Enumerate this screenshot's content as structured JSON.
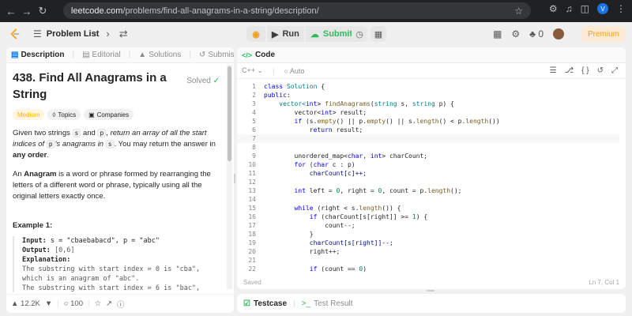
{
  "browser": {
    "url_host": "leetcode.com",
    "url_path": "/problems/find-all-anagrams-in-a-string/description/",
    "profile_initial": "V"
  },
  "topbar": {
    "problem_list_label": "Problem List",
    "run_label": "Run",
    "submit_label": "Submit",
    "fire_count": "0",
    "premium_label": "Premium"
  },
  "left": {
    "tabs": [
      {
        "label": "Description"
      },
      {
        "label": "Editorial"
      },
      {
        "label": "Solutions"
      },
      {
        "label": "Submissions"
      }
    ],
    "title": "438. Find All Anagrams in a String",
    "solved_label": "Solved",
    "chips": {
      "difficulty": "Medium",
      "topics": "Topics",
      "companies": "Companies"
    },
    "desc1": {
      "a": "Given two strings ",
      "s": "s",
      "b": " and ",
      "p": "p",
      "c": ", ",
      "d": "return an array of all the start indices of ",
      "p2": "p",
      "e": "'s anagrams in ",
      "s2": "s",
      "f": ". You may return the answer in ",
      "g": "any order",
      "h": "."
    },
    "desc2": {
      "a": "An ",
      "b": "Anagram",
      "c": " is a word or phrase formed by rearranging the letters of a different word or phrase, typically using all the original letters exactly once."
    },
    "example_title": "Example 1:",
    "example": {
      "input_label": "Input:",
      "input_value": " s = \"cbaebabacd\", p = \"abc\"",
      "output_label": "Output:",
      "output_value": " [0,6]",
      "explanation_label": "Explanation:",
      "lines": [
        "The substring with start index = 0 is \"cba\",",
        "which is an anagram of \"abc\".",
        "The substring with start index = 6 is \"bac\","
      ]
    },
    "footer": {
      "likes": "12.2K",
      "comments": "100"
    }
  },
  "editor": {
    "tab_label": "Code",
    "language": "C++",
    "mode": "Auto",
    "code_lines": [
      [
        {
          "t": "class ",
          "c": "kw"
        },
        {
          "t": "Solution",
          "c": "ty"
        },
        {
          "t": " {"
        }
      ],
      [
        {
          "t": "public",
          "c": "kw"
        },
        {
          "t": ":"
        }
      ],
      [
        {
          "t": "    vector<",
          "c": "ty"
        },
        {
          "t": "int",
          "c": "kw"
        },
        {
          "t": "> "
        },
        {
          "t": "findAnagrams",
          "c": "fn"
        },
        {
          "t": "("
        },
        {
          "t": "string",
          "c": "ty"
        },
        {
          "t": " s, "
        },
        {
          "t": "string",
          "c": "ty"
        },
        {
          "t": " p) {"
        }
      ],
      [
        {
          "t": "        vector<"
        },
        {
          "t": "int",
          "c": "kw"
        },
        {
          "t": "> result;"
        }
      ],
      [
        {
          "t": "        "
        },
        {
          "t": "if",
          "c": "kw"
        },
        {
          "t": " (s."
        },
        {
          "t": "empty",
          "c": "fn"
        },
        {
          "t": "() || p."
        },
        {
          "t": "empty",
          "c": "fn"
        },
        {
          "t": "() || s."
        },
        {
          "t": "length",
          "c": "fn"
        },
        {
          "t": "() < p."
        },
        {
          "t": "length",
          "c": "fn"
        },
        {
          "t": "())"
        }
      ],
      [
        {
          "t": "            "
        },
        {
          "t": "return",
          "c": "kw"
        },
        {
          "t": " result;"
        }
      ],
      [
        {
          "t": ""
        }
      ],
      [
        {
          "t": ""
        }
      ],
      [
        {
          "t": "        unordered_map<"
        },
        {
          "t": "char",
          "c": "kw"
        },
        {
          "t": ", "
        },
        {
          "t": "int",
          "c": "kw"
        },
        {
          "t": "> charCount;"
        }
      ],
      [
        {
          "t": "        "
        },
        {
          "t": "for",
          "c": "kw"
        },
        {
          "t": " ("
        },
        {
          "t": "char",
          "c": "kw"
        },
        {
          "t": " c : p)"
        }
      ],
      [
        {
          "t": "            charCount[c]++;",
          "c": "va"
        }
      ],
      [
        {
          "t": ""
        }
      ],
      [
        {
          "t": "        "
        },
        {
          "t": "int",
          "c": "kw"
        },
        {
          "t": " left = "
        },
        {
          "t": "0",
          "c": "nu"
        },
        {
          "t": ", right = "
        },
        {
          "t": "0",
          "c": "nu"
        },
        {
          "t": ", count = p."
        },
        {
          "t": "length",
          "c": "fn"
        },
        {
          "t": "();"
        }
      ],
      [
        {
          "t": ""
        }
      ],
      [
        {
          "t": "        "
        },
        {
          "t": "while",
          "c": "kw"
        },
        {
          "t": " (right < s."
        },
        {
          "t": "length",
          "c": "fn"
        },
        {
          "t": "()) {"
        }
      ],
      [
        {
          "t": "            "
        },
        {
          "t": "if",
          "c": "kw"
        },
        {
          "t": " (charCount[s[right]] >= "
        },
        {
          "t": "1",
          "c": "nu"
        },
        {
          "t": ") {"
        }
      ],
      [
        {
          "t": "                count--;"
        }
      ],
      [
        {
          "t": "            }"
        }
      ],
      [
        {
          "t": "            "
        },
        {
          "t": "charCount[s[right]]--;",
          "c": "va"
        }
      ],
      [
        {
          "t": "            right++;"
        }
      ],
      [
        {
          "t": ""
        }
      ],
      [
        {
          "t": "            "
        },
        {
          "t": "if",
          "c": "kw"
        },
        {
          "t": " (count == "
        },
        {
          "t": "0",
          "c": "nu"
        },
        {
          "t": ")"
        }
      ]
    ],
    "status_left": "Saved",
    "status_right": "Ln 7, Col 1"
  },
  "bottom": {
    "testcase_label": "Testcase",
    "result_label": "Test Result"
  }
}
